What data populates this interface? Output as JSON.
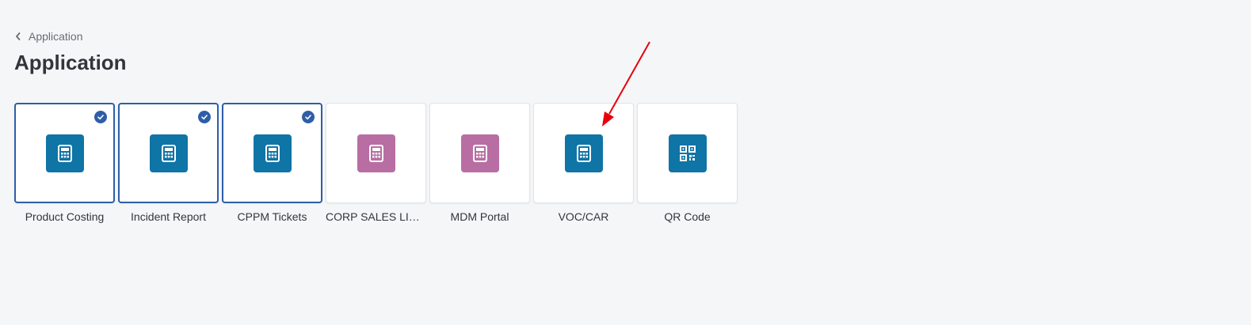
{
  "breadcrumb": {
    "label": "Application"
  },
  "page": {
    "title": "Application"
  },
  "colors": {
    "accent_blue": "#0f74a6",
    "accent_purple": "#b86ea3",
    "selected_border": "#2f5ea8",
    "annotation_red": "#e8000b"
  },
  "tiles": [
    {
      "label": "Product Costing",
      "icon": "calculator-icon",
      "color": "#0f74a6",
      "selected": true
    },
    {
      "label": "Incident Report",
      "icon": "calculator-icon",
      "color": "#0f74a6",
      "selected": true
    },
    {
      "label": "CPPM Tickets",
      "icon": "calculator-icon",
      "color": "#0f74a6",
      "selected": true
    },
    {
      "label": "CORP SALES LIBRA...",
      "icon": "calculator-icon",
      "color": "#b86ea3",
      "selected": false
    },
    {
      "label": "MDM Portal",
      "icon": "calculator-icon",
      "color": "#b86ea3",
      "selected": false
    },
    {
      "label": "VOC/CAR",
      "icon": "calculator-icon",
      "color": "#0f74a6",
      "selected": false
    },
    {
      "label": "QR Code",
      "icon": "qr-code-icon",
      "color": "#0f74a6",
      "selected": false
    }
  ]
}
